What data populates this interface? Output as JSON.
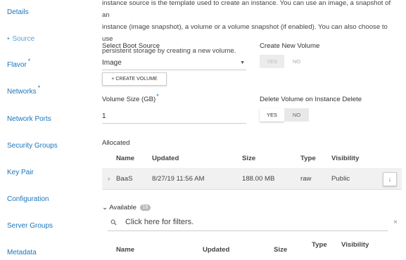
{
  "sidebar": {
    "items": [
      {
        "label": "Details"
      },
      {
        "label": "Source",
        "active": true
      },
      {
        "label": "Flavor",
        "required": "*"
      },
      {
        "label": "Networks",
        "required": "*"
      },
      {
        "label": "Network Ports"
      },
      {
        "label": "Security Groups"
      },
      {
        "label": "Key Pair"
      },
      {
        "label": "Configuration"
      },
      {
        "label": "Server Groups"
      },
      {
        "label": "Metadata"
      }
    ],
    "active_marker": "•"
  },
  "intro": {
    "line1": "instance source is the template used to create an instance. You can use an image, a snapshot of an",
    "line2": "instance (image snapshot), a volume or a volume snapshot (if enabled). You can also choose to use",
    "line3": "persistent storage by creating a new volume."
  },
  "boot_source": {
    "label": "Select Boot Source",
    "value": "Image",
    "caret": "▼"
  },
  "create_volume_button": "+ CREATE VOLUME",
  "create_new_volume": {
    "label": "Create New Volume",
    "yes": "YES",
    "no": "NO",
    "selected": "YES"
  },
  "volume_size": {
    "label": "Volume Size (GB)",
    "required": "*",
    "value": "1"
  },
  "delete_on_delete": {
    "label": "Delete Volume on Instance Delete",
    "yes": "YES",
    "no": "NO",
    "selected": "YES"
  },
  "allocated": {
    "title": "Allocated",
    "columns": [
      "Name",
      "Updated",
      "Size",
      "Type",
      "Visibility"
    ],
    "rows": [
      {
        "expand": "›",
        "name": "BaaS",
        "updated": "8/27/19 11:56 AM",
        "size": "188.00 MB",
        "type": "raw",
        "visibility": "Public",
        "action": "↓"
      }
    ]
  },
  "available": {
    "chevron": "⌄",
    "title": "Available",
    "count": "16",
    "filter_placeholder": "Click here for filters.",
    "filter_icon": "search-icon",
    "clear": "×",
    "columns": [
      "Name",
      "Updated",
      "Size",
      "Type",
      "Visibility"
    ]
  },
  "colors": {
    "link": "#1b75bb",
    "active_link": "#5aa0d8",
    "row_bg": "#f1f1f1",
    "badge": "#b9b9b9"
  }
}
